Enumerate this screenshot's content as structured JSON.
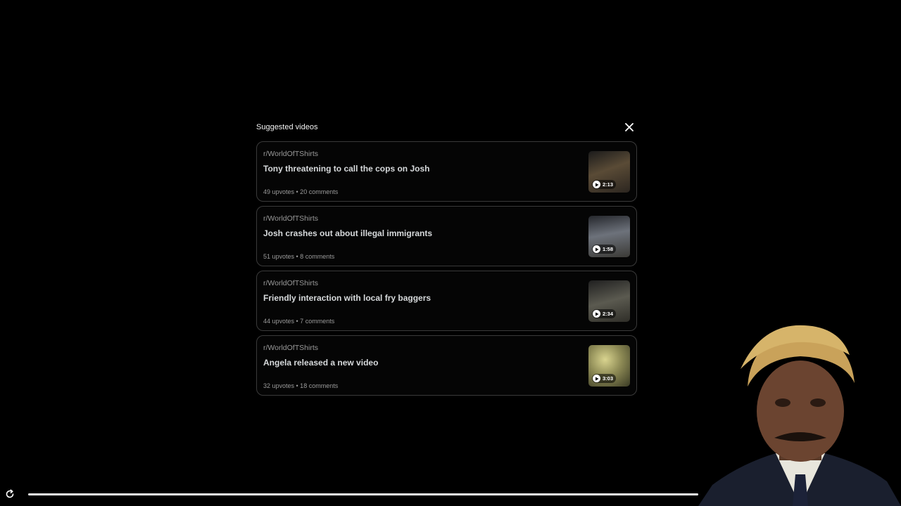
{
  "panel": {
    "title": "Suggested videos",
    "close_icon": "close-icon"
  },
  "videos": [
    {
      "subreddit": "r/WorldOfTShirts",
      "title": "Tony threatening to call the cops on Josh",
      "meta": "49 upvotes • 20 comments",
      "duration": "2:13",
      "thumb_color": "#3b3226"
    },
    {
      "subreddit": "r/WorldOfTShirts",
      "title": "Josh crashes out about illegal immigrants",
      "meta": "51 upvotes • 8 comments",
      "duration": "1:58",
      "thumb_color": "#4a4f58"
    },
    {
      "subreddit": "r/WorldOfTShirts",
      "title": "Friendly interaction with local fry baggers",
      "meta": "44 upvotes • 7 comments",
      "duration": "2:34",
      "thumb_color": "#3c3c36"
    },
    {
      "subreddit": "r/WorldOfTShirts",
      "title": "Angela released a new video",
      "meta": "32 upvotes • 18 comments",
      "duration": "3:03",
      "thumb_color": "#a7a66a"
    }
  ],
  "player": {
    "reload_icon": "reload-icon",
    "progress": 1.0
  },
  "overlay": {
    "image": "person-portrait"
  }
}
